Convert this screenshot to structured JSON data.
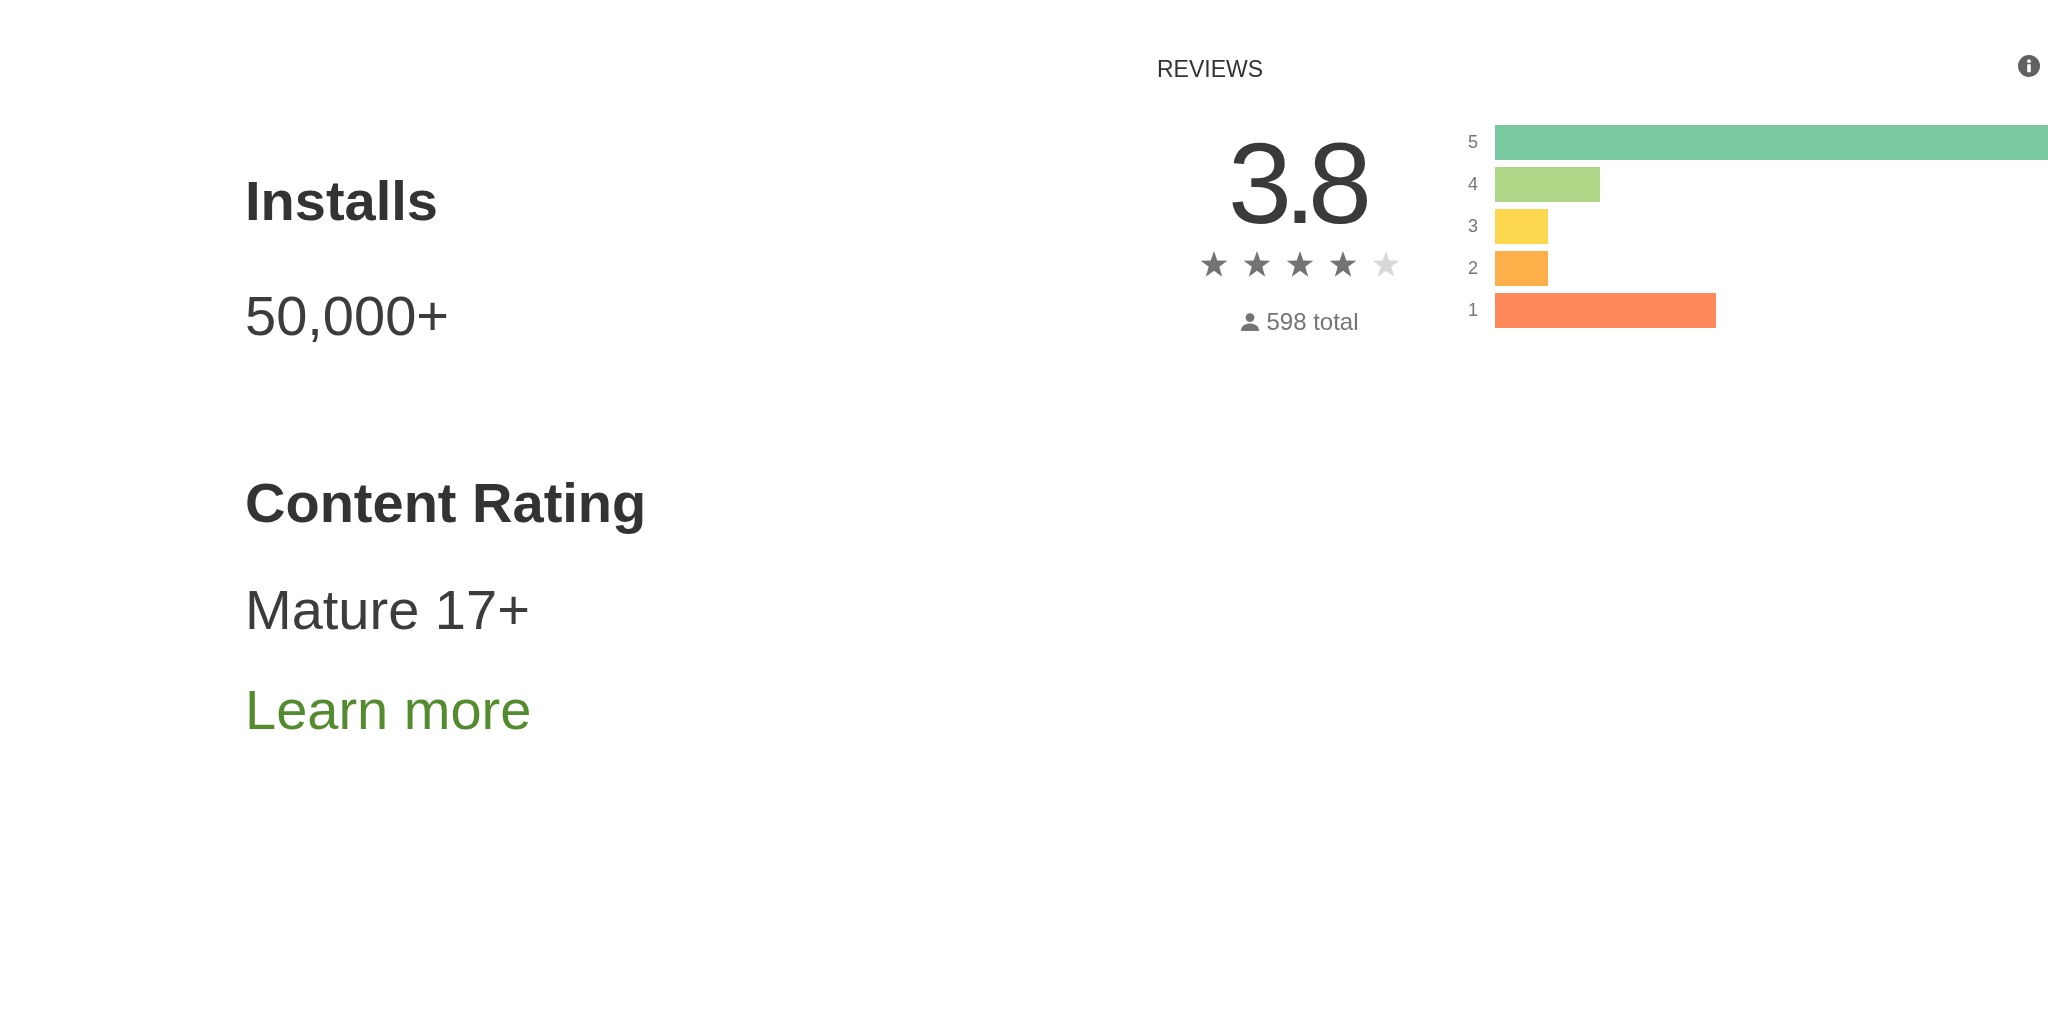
{
  "reviews": {
    "title": "REVIEWS",
    "rating": "3.8",
    "stars": 4,
    "total": "598 total",
    "rating_bars": [
      {
        "label": "5",
        "color": "#7ac8a1"
      },
      {
        "label": "4",
        "color": "#add787"
      },
      {
        "label": "3",
        "color": "#fdd84e"
      },
      {
        "label": "2",
        "color": "#fdb04a"
      },
      {
        "label": "1",
        "color": "#fe8a5b"
      }
    ]
  },
  "details": [
    {
      "heading": "Installs",
      "value": "50,000+"
    },
    {
      "heading": "Content Rating",
      "value": "Mature 17+",
      "link": "Learn more"
    }
  ]
}
